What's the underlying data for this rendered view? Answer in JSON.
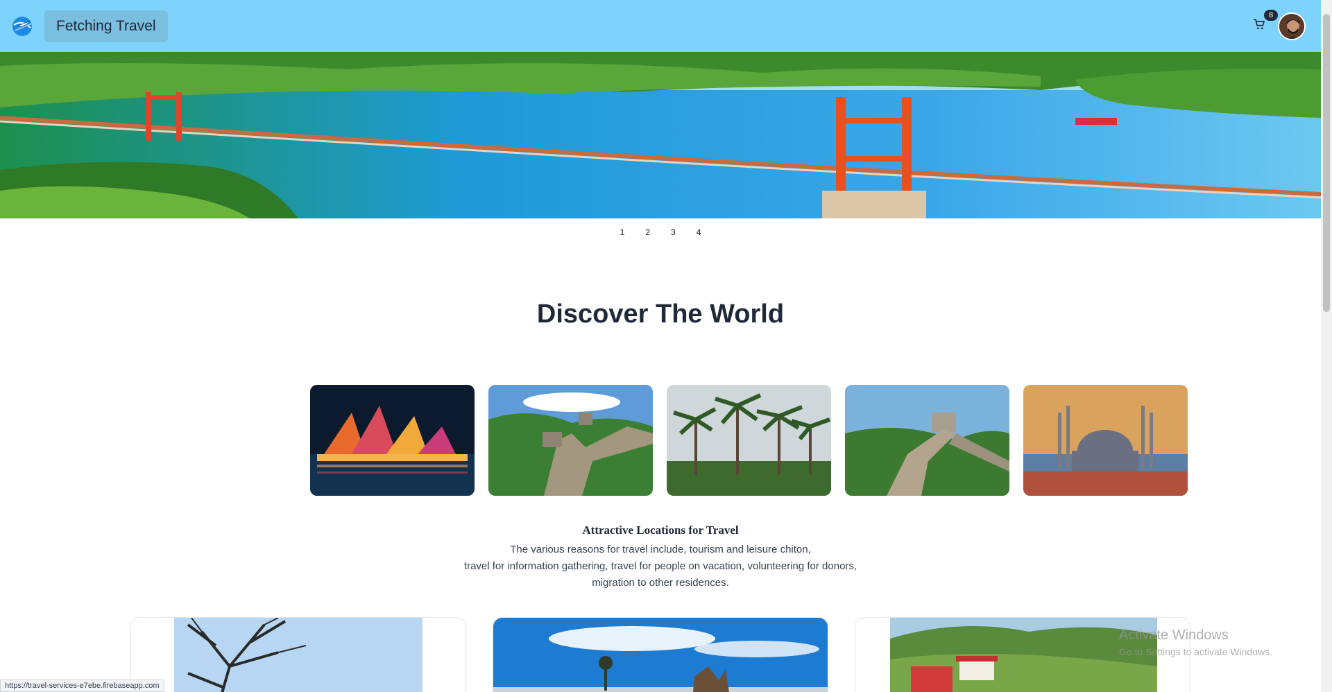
{
  "navbar": {
    "brand": "Fetching Travel",
    "logo_icon": "airplane-globe-icon",
    "cart_icon": "cart-icon",
    "cart_count": "8",
    "avatar": "user-avatar"
  },
  "hero": {
    "image": "suspension-bridge-over-lake",
    "pages": [
      "1",
      "2",
      "3",
      "4"
    ]
  },
  "discover": {
    "title": "Discover The World",
    "thumbnails": [
      "sydney-opera-house",
      "great-wall",
      "palm-trees",
      "great-wall-tower",
      "blue-mosque"
    ]
  },
  "about": {
    "heading": "Attractive Locations for Travel",
    "lines": [
      "The various reasons for travel include, tourism and leisure chiton,",
      "travel for information gathering, travel for people on vacation, volunteering for donors,",
      "migration to other residences."
    ]
  },
  "status_bar": {
    "url": "https://travel-services-e7ebe.firebaseapp.com"
  },
  "watermark": {
    "title": "Activate Windows",
    "subtitle": "Go to Settings to activate Windows."
  },
  "colors": {
    "navbar": "#7dd3fc",
    "brand_button": "#7bbfe0",
    "badge": "#1f2937"
  }
}
